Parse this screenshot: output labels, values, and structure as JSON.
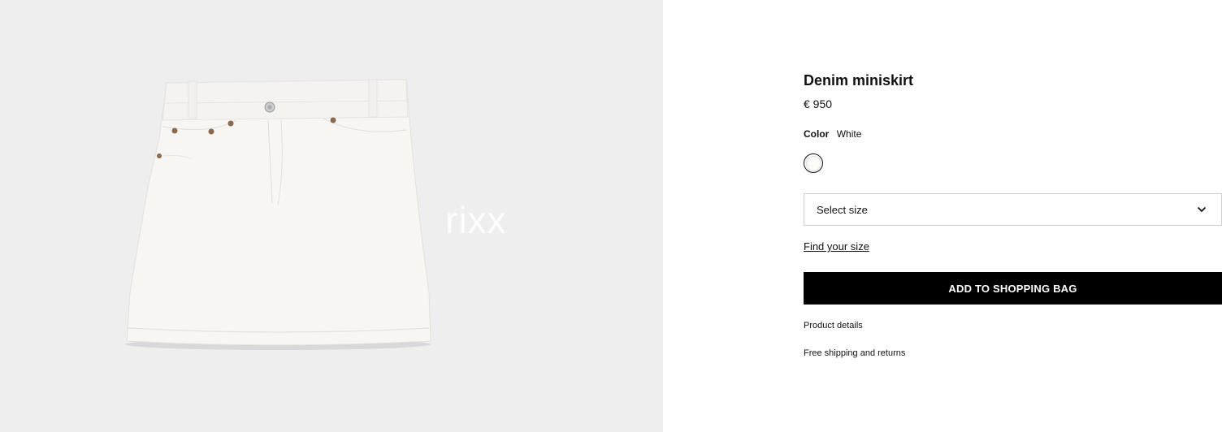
{
  "gallery": {
    "watermark": "rixx"
  },
  "product": {
    "title": "Denim miniskirt",
    "price": "€ 950",
    "color_label": "Color",
    "color_value": "White",
    "swatch_color": "#fbfbf8"
  },
  "size_select": {
    "label": "Select size",
    "icon": "chevron-down-icon"
  },
  "links": {
    "find_size": "Find your size",
    "product_details": "Product details",
    "shipping": "Free shipping and returns"
  },
  "cta": {
    "add_to_bag": "ADD TO SHOPPING BAG"
  },
  "colors": {
    "gallery_bg": "#eeeeef",
    "cta_bg": "#000000",
    "cta_text": "#ffffff"
  }
}
